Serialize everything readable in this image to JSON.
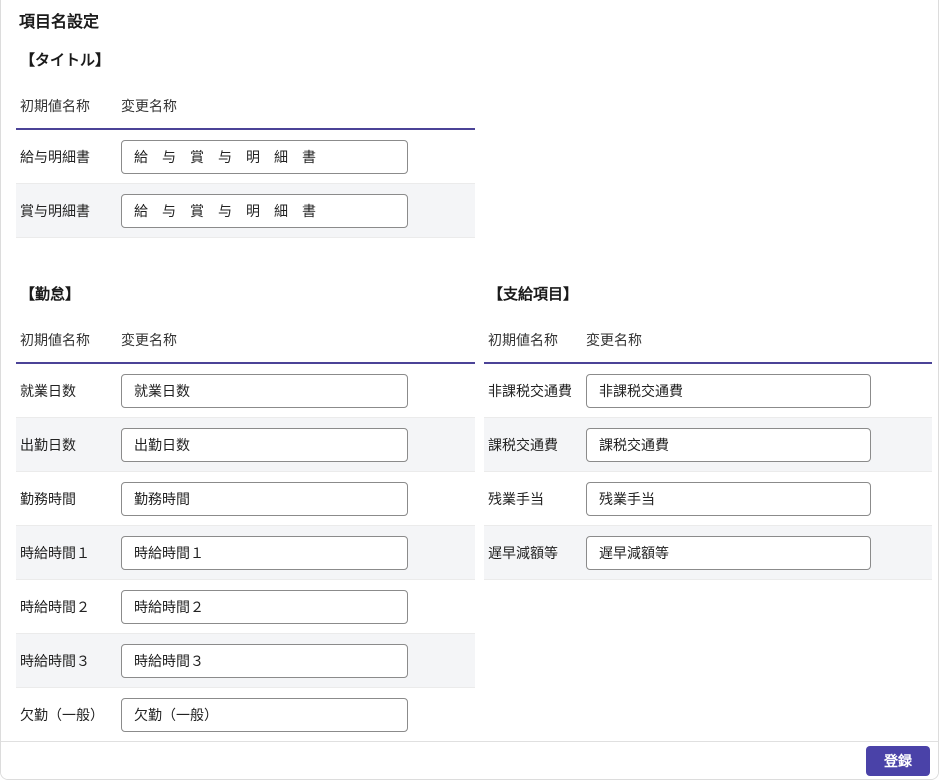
{
  "page": {
    "title": "項目名設定"
  },
  "colors": {
    "accent": "#4a42a8",
    "header_rule": "#4b4397",
    "row_stripe": "#f4f5f7",
    "input_border": "#8b8b8b"
  },
  "sections": {
    "title": {
      "heading": "【タイトル】",
      "col_initial": "初期値名称",
      "col_changed": "変更名称",
      "rows": [
        {
          "label": "給与明細書",
          "value": "給　与　賞　与　明　細　書"
        },
        {
          "label": "賞与明細書",
          "value": "給　与　賞　与　明　細　書"
        }
      ]
    },
    "attendance": {
      "heading": "【勤怠】",
      "col_initial": "初期値名称",
      "col_changed": "変更名称",
      "rows": [
        {
          "label": "就業日数",
          "value": "就業日数"
        },
        {
          "label": "出勤日数",
          "value": "出勤日数"
        },
        {
          "label": "勤務時間",
          "value": "勤務時間"
        },
        {
          "label": "時給時間１",
          "value": "時給時間１"
        },
        {
          "label": "時給時間２",
          "value": "時給時間２"
        },
        {
          "label": "時給時間３",
          "value": "時給時間３"
        },
        {
          "label": "欠勤（一般）",
          "value": "欠勤（一般）"
        }
      ]
    },
    "payment": {
      "heading": "【支給項目】",
      "col_initial": "初期値名称",
      "col_changed": "変更名称",
      "rows": [
        {
          "label": "非課税交通費",
          "value": "非課税交通費"
        },
        {
          "label": "課税交通費",
          "value": "課税交通費"
        },
        {
          "label": "残業手当",
          "value": "残業手当"
        },
        {
          "label": "遅早減額等",
          "value": "遅早減額等"
        }
      ]
    }
  },
  "footer": {
    "submit_label": "登録"
  }
}
